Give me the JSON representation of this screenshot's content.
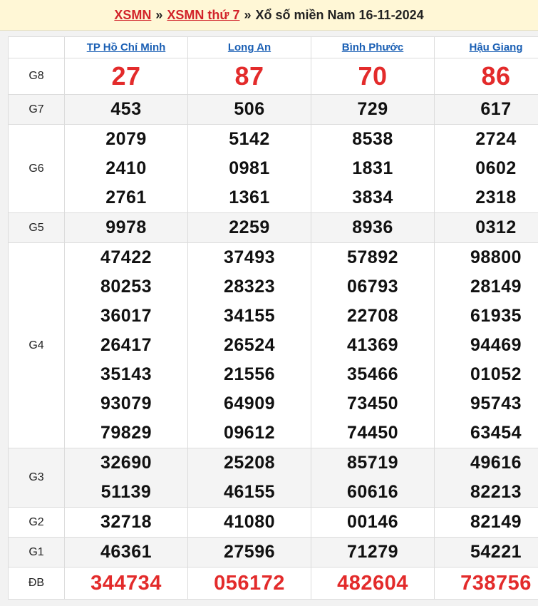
{
  "header": {
    "link1": "XSMN",
    "sep1": "»",
    "link2": "XSMN thứ 7",
    "sep2": "»",
    "title": "Xổ số miền Nam 16-11-2024"
  },
  "provinces": [
    "TP Hồ Chí Minh",
    "Long An",
    "Bình Phước",
    "Hậu Giang"
  ],
  "rows": {
    "g8": {
      "label": "G8",
      "values": [
        [
          "27"
        ],
        [
          "87"
        ],
        [
          "70"
        ],
        [
          "86"
        ]
      ]
    },
    "g7": {
      "label": "G7",
      "values": [
        [
          "453"
        ],
        [
          "506"
        ],
        [
          "729"
        ],
        [
          "617"
        ]
      ]
    },
    "g6": {
      "label": "G6",
      "values": [
        [
          "2079",
          "2410",
          "2761"
        ],
        [
          "5142",
          "0981",
          "1361"
        ],
        [
          "8538",
          "1831",
          "3834"
        ],
        [
          "2724",
          "0602",
          "2318"
        ]
      ]
    },
    "g5": {
      "label": "G5",
      "values": [
        [
          "9978"
        ],
        [
          "2259"
        ],
        [
          "8936"
        ],
        [
          "0312"
        ]
      ]
    },
    "g4": {
      "label": "G4",
      "values": [
        [
          "47422",
          "80253",
          "36017",
          "26417",
          "35143",
          "93079",
          "79829"
        ],
        [
          "37493",
          "28323",
          "34155",
          "26524",
          "21556",
          "64909",
          "09612"
        ],
        [
          "57892",
          "06793",
          "22708",
          "41369",
          "35466",
          "73450",
          "74450"
        ],
        [
          "98800",
          "28149",
          "61935",
          "94469",
          "01052",
          "95743",
          "63454"
        ]
      ]
    },
    "g3": {
      "label": "G3",
      "values": [
        [
          "32690",
          "51139"
        ],
        [
          "25208",
          "46155"
        ],
        [
          "85719",
          "60616"
        ],
        [
          "49616",
          "82213"
        ]
      ]
    },
    "g2": {
      "label": "G2",
      "values": [
        [
          "32718"
        ],
        [
          "41080"
        ],
        [
          "00146"
        ],
        [
          "82149"
        ]
      ]
    },
    "g1": {
      "label": "G1",
      "values": [
        [
          "46361"
        ],
        [
          "27596"
        ],
        [
          "71279"
        ],
        [
          "54221"
        ]
      ]
    },
    "db": {
      "label": "ĐB",
      "values": [
        [
          "344734"
        ],
        [
          "056172"
        ],
        [
          "482604"
        ],
        [
          "738756"
        ]
      ]
    }
  },
  "colors": {
    "accent_red": "#e32b2b",
    "link_blue": "#1a5fb4",
    "header_bg": "#fff7d6"
  }
}
